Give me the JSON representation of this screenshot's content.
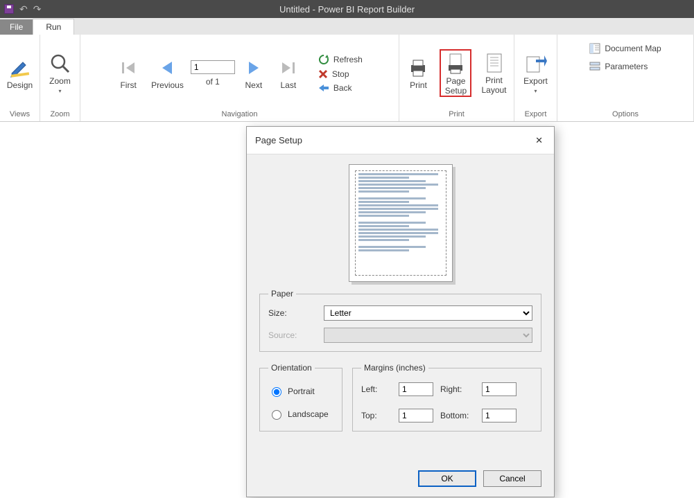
{
  "titlebar": {
    "title": "Untitled - Power BI Report Builder"
  },
  "tabs": {
    "file": "File",
    "run": "Run"
  },
  "ribbon": {
    "views": {
      "label": "Views",
      "design": "Design"
    },
    "zoom": {
      "label": "Zoom",
      "zoom": "Zoom"
    },
    "navigation": {
      "label": "Navigation",
      "first": "First",
      "previous": "Previous",
      "page_value": "1",
      "of_text": "of  1",
      "next": "Next",
      "last": "Last",
      "refresh": "Refresh",
      "stop": "Stop",
      "back": "Back"
    },
    "print": {
      "label": "Print",
      "print": "Print",
      "page_setup": "Page\nSetup",
      "print_layout": "Print\nLayout"
    },
    "export": {
      "label": "Export",
      "export": "Export"
    },
    "options": {
      "label": "Options",
      "doc_map": "Document Map",
      "parameters": "Parameters"
    }
  },
  "dialog": {
    "title": "Page Setup",
    "paper": {
      "legend": "Paper",
      "size_label": "Size:",
      "size_value": "Letter",
      "source_label": "Source:"
    },
    "orientation": {
      "legend": "Orientation",
      "portrait": "Portrait",
      "landscape": "Landscape",
      "selected": "portrait"
    },
    "margins": {
      "legend": "Margins (inches)",
      "left_label": "Left:",
      "left_value": "1",
      "right_label": "Right:",
      "right_value": "1",
      "top_label": "Top:",
      "top_value": "1",
      "bottom_label": "Bottom:",
      "bottom_value": "1"
    },
    "ok": "OK",
    "cancel": "Cancel"
  }
}
